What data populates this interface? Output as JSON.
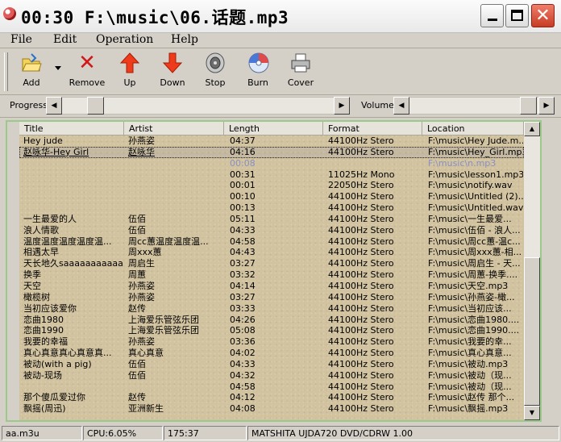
{
  "window": {
    "title": "00:30 F:\\music\\06.话题.mp3"
  },
  "menu": [
    {
      "label": "File"
    },
    {
      "label": "Edit"
    },
    {
      "label": "Operation"
    },
    {
      "label": "Help"
    }
  ],
  "toolbar": [
    {
      "label": "Add",
      "icon": "open-folder-icon"
    },
    {
      "label": "Remove",
      "icon": "red-x-icon"
    },
    {
      "label": "Up",
      "icon": "up-arrow-icon"
    },
    {
      "label": "Down",
      "icon": "down-arrow-icon"
    },
    {
      "label": "Stop",
      "icon": "speaker-icon"
    },
    {
      "label": "Burn",
      "icon": "cd-icon"
    },
    {
      "label": "Cover",
      "icon": "printer-icon"
    }
  ],
  "sliders": {
    "progress_label": "Progress",
    "volume_label": "Volume"
  },
  "columns": [
    "Title",
    "Artist",
    "Length",
    "Format",
    "Location"
  ],
  "rows": [
    {
      "title": "Hey jude",
      "artist": "孙燕姿",
      "length": "04:37",
      "format": "44100Hz Stero",
      "location": "F:\\music\\Hey Jude.m..."
    },
    {
      "title": "赵咏华-Hey Girl",
      "artist": "赵咏华",
      "length": "04:16",
      "format": "44100Hz Stero",
      "location": "F:\\music\\Hey_Girl.mp3"
    },
    {
      "title": "",
      "artist": "",
      "length": "00:08",
      "format": "",
      "location": "F:\\music\\n.mp3"
    },
    {
      "title": "",
      "artist": "",
      "length": "00:31",
      "format": "11025Hz Mono",
      "location": "F:\\music\\lesson1.mp3"
    },
    {
      "title": "",
      "artist": "",
      "length": "00:01",
      "format": "22050Hz Stero",
      "location": "F:\\music\\notify.wav"
    },
    {
      "title": "",
      "artist": "",
      "length": "00:10",
      "format": "44100Hz Stero",
      "location": "F:\\music\\Untitled (2)...."
    },
    {
      "title": "",
      "artist": "",
      "length": "00:13",
      "format": "44100Hz Stero",
      "location": "F:\\music\\Untitled.wav"
    },
    {
      "title": "一生最爱的人",
      "artist": "伍佰",
      "length": "05:11",
      "format": "44100Hz Stero",
      "location": "F:\\music\\一生最爱..."
    },
    {
      "title": "浪人情歌",
      "artist": "伍佰",
      "length": "04:33",
      "format": "44100Hz Stero",
      "location": "F:\\music\\伍佰 - 浪人..."
    },
    {
      "title": "温度温度温度温度温...",
      "artist": "周cc蕙温度温度温...",
      "length": "04:58",
      "format": "44100Hz Stero",
      "location": "F:\\music\\周cc蕙-温c..."
    },
    {
      "title": "相遇太早",
      "artist": "周xxx蕙",
      "length": "04:43",
      "format": "44100Hz Stero",
      "location": "F:\\music\\周xxx蕙-相..."
    },
    {
      "title": "天长地久saaaaaaaaaaa",
      "artist": "周启生",
      "length": "03:27",
      "format": "44100Hz Stero",
      "location": "F:\\music\\周启生 - 天..."
    },
    {
      "title": "换季",
      "artist": "周蕙",
      "length": "03:32",
      "format": "44100Hz Stero",
      "location": "F:\\music\\周蕙-换季...."
    },
    {
      "title": "天空",
      "artist": "孙燕姿",
      "length": "04:14",
      "format": "44100Hz Stero",
      "location": "F:\\music\\天空.mp3"
    },
    {
      "title": "橄榄树",
      "artist": "孙燕姿",
      "length": "03:27",
      "format": "44100Hz Stero",
      "location": "F:\\music\\孙燕姿-橄..."
    },
    {
      "title": "当初应该爱你",
      "artist": "赵传",
      "length": "03:33",
      "format": "44100Hz Stero",
      "location": "F:\\music\\当初应该..."
    },
    {
      "title": "恋曲1980",
      "artist": "上海爱乐管弦乐团",
      "length": "04:26",
      "format": "44100Hz Stero",
      "location": "F:\\music\\恋曲1980...."
    },
    {
      "title": "恋曲1990",
      "artist": "上海爱乐管弦乐团",
      "length": "05:08",
      "format": "44100Hz Stero",
      "location": "F:\\music\\恋曲1990...."
    },
    {
      "title": "我要的幸福",
      "artist": "孙燕姿",
      "length": "03:36",
      "format": "44100Hz Stero",
      "location": "F:\\music\\我要的幸..."
    },
    {
      "title": "真心真意真心真意真...",
      "artist": "真心真意",
      "length": "04:02",
      "format": "44100Hz Stero",
      "location": "F:\\music\\真心真意..."
    },
    {
      "title": "被动(with a pig)",
      "artist": "伍佰",
      "length": "04:33",
      "format": "44100Hz Stero",
      "location": "F:\\music\\被动.mp3"
    },
    {
      "title": "被动-现场",
      "artist": "伍佰",
      "length": "04:32",
      "format": "44100Hz Stero",
      "location": "F:\\music\\被动（现..."
    },
    {
      "title": "",
      "artist": "",
      "length": "04:58",
      "format": "44100Hz Stero",
      "location": "F:\\music\\被动（现..."
    },
    {
      "title": "那个傻瓜爱过你",
      "artist": "赵传",
      "length": "04:12",
      "format": "44100Hz Stero",
      "location": "F:\\music\\赵传 那个..."
    },
    {
      "title": "飘摇(周迅)",
      "artist": "亚洲新生",
      "length": "04:08",
      "format": "44100Hz Stero",
      "location": "F:\\music\\飘摇.mp3"
    }
  ],
  "status": {
    "playlist": "aa.m3u",
    "cpu": "CPU:6.05%",
    "total": "175:37",
    "drive": "MATSHITA UJDA720 DVD/CDRW 1.00"
  },
  "progress": {
    "value_fraction": 0.0
  }
}
